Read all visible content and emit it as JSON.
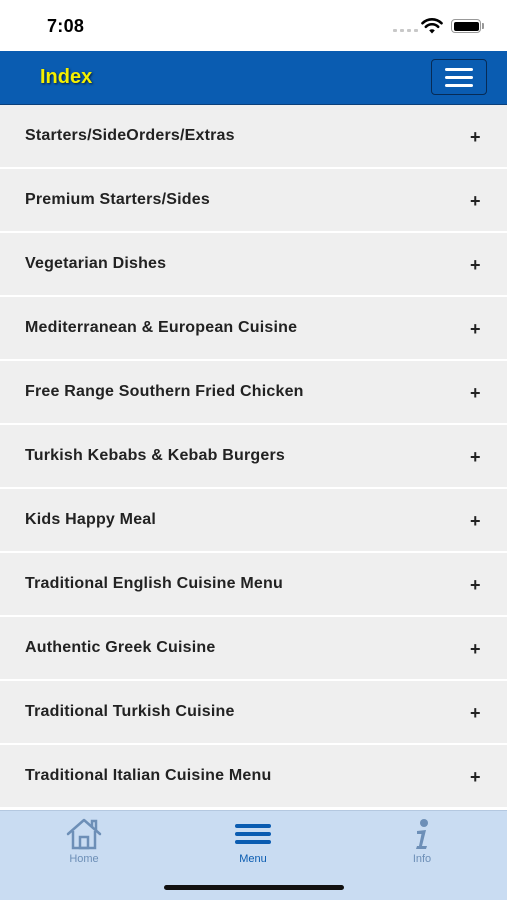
{
  "status_bar": {
    "time": "7:08"
  },
  "header": {
    "title": "Index"
  },
  "menu_items": [
    {
      "label": "Starters/SideOrders/Extras",
      "expand": "+"
    },
    {
      "label": "Premium Starters/Sides",
      "expand": "+"
    },
    {
      "label": "Vegetarian Dishes",
      "expand": "+"
    },
    {
      "label": "Mediterranean & European Cuisine",
      "expand": "+"
    },
    {
      "label": "Free Range Southern Fried Chicken",
      "expand": "+"
    },
    {
      "label": "Turkish Kebabs & Kebab Burgers",
      "expand": "+"
    },
    {
      "label": "Kids Happy Meal",
      "expand": "+"
    },
    {
      "label": "Traditional English Cuisine Menu",
      "expand": "+"
    },
    {
      "label": "Authentic Greek Cuisine",
      "expand": "+"
    },
    {
      "label": "Traditional Turkish Cuisine",
      "expand": "+"
    },
    {
      "label": "Traditional Italian Cuisine Menu",
      "expand": "+"
    }
  ],
  "tab_bar": {
    "tabs": [
      {
        "label": "Home",
        "icon": "home-icon",
        "active": false
      },
      {
        "label": "Menu",
        "icon": "menu-icon",
        "active": true
      },
      {
        "label": "Info",
        "icon": "info-icon",
        "active": false
      }
    ]
  },
  "colors": {
    "nav_background": "#0a5cb1",
    "title": "#f4f000",
    "list_background": "#efefef",
    "tab_bar_background": "#c9dcf2",
    "tab_active": "#0a5cb1",
    "tab_inactive": "#6d8fb7"
  }
}
